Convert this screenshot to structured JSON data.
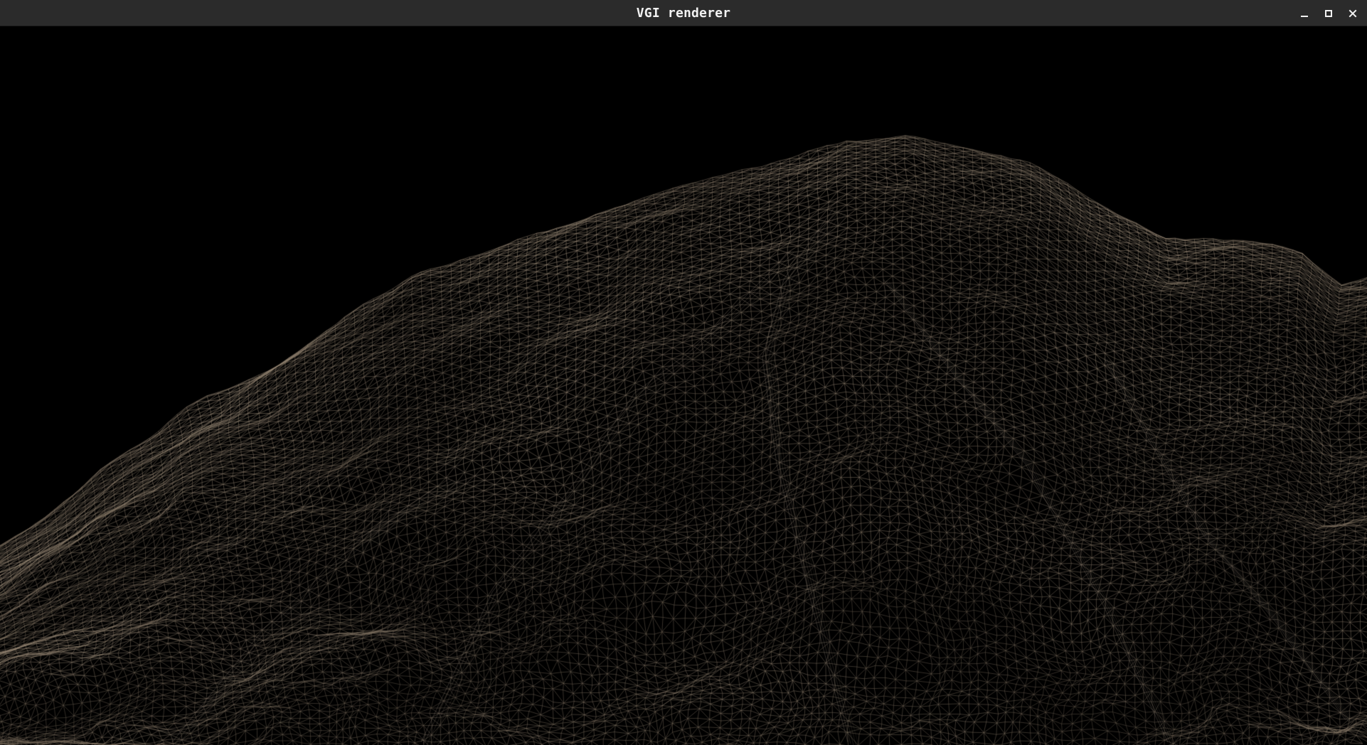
{
  "window": {
    "title": "VGI renderer",
    "controls": {
      "minimize_icon": "minimize-icon",
      "maximize_icon": "maximize-icon",
      "close_icon": "close-icon"
    }
  },
  "viewport": {
    "background": "#000000",
    "render_mode": "wireframe",
    "subject": "terrain-mesh",
    "wire_color": "#8c8175",
    "wire_highlight": "#cdbfae",
    "titlebar_color": "#2b2b2b",
    "title_text_color": "#f2f2f2"
  }
}
